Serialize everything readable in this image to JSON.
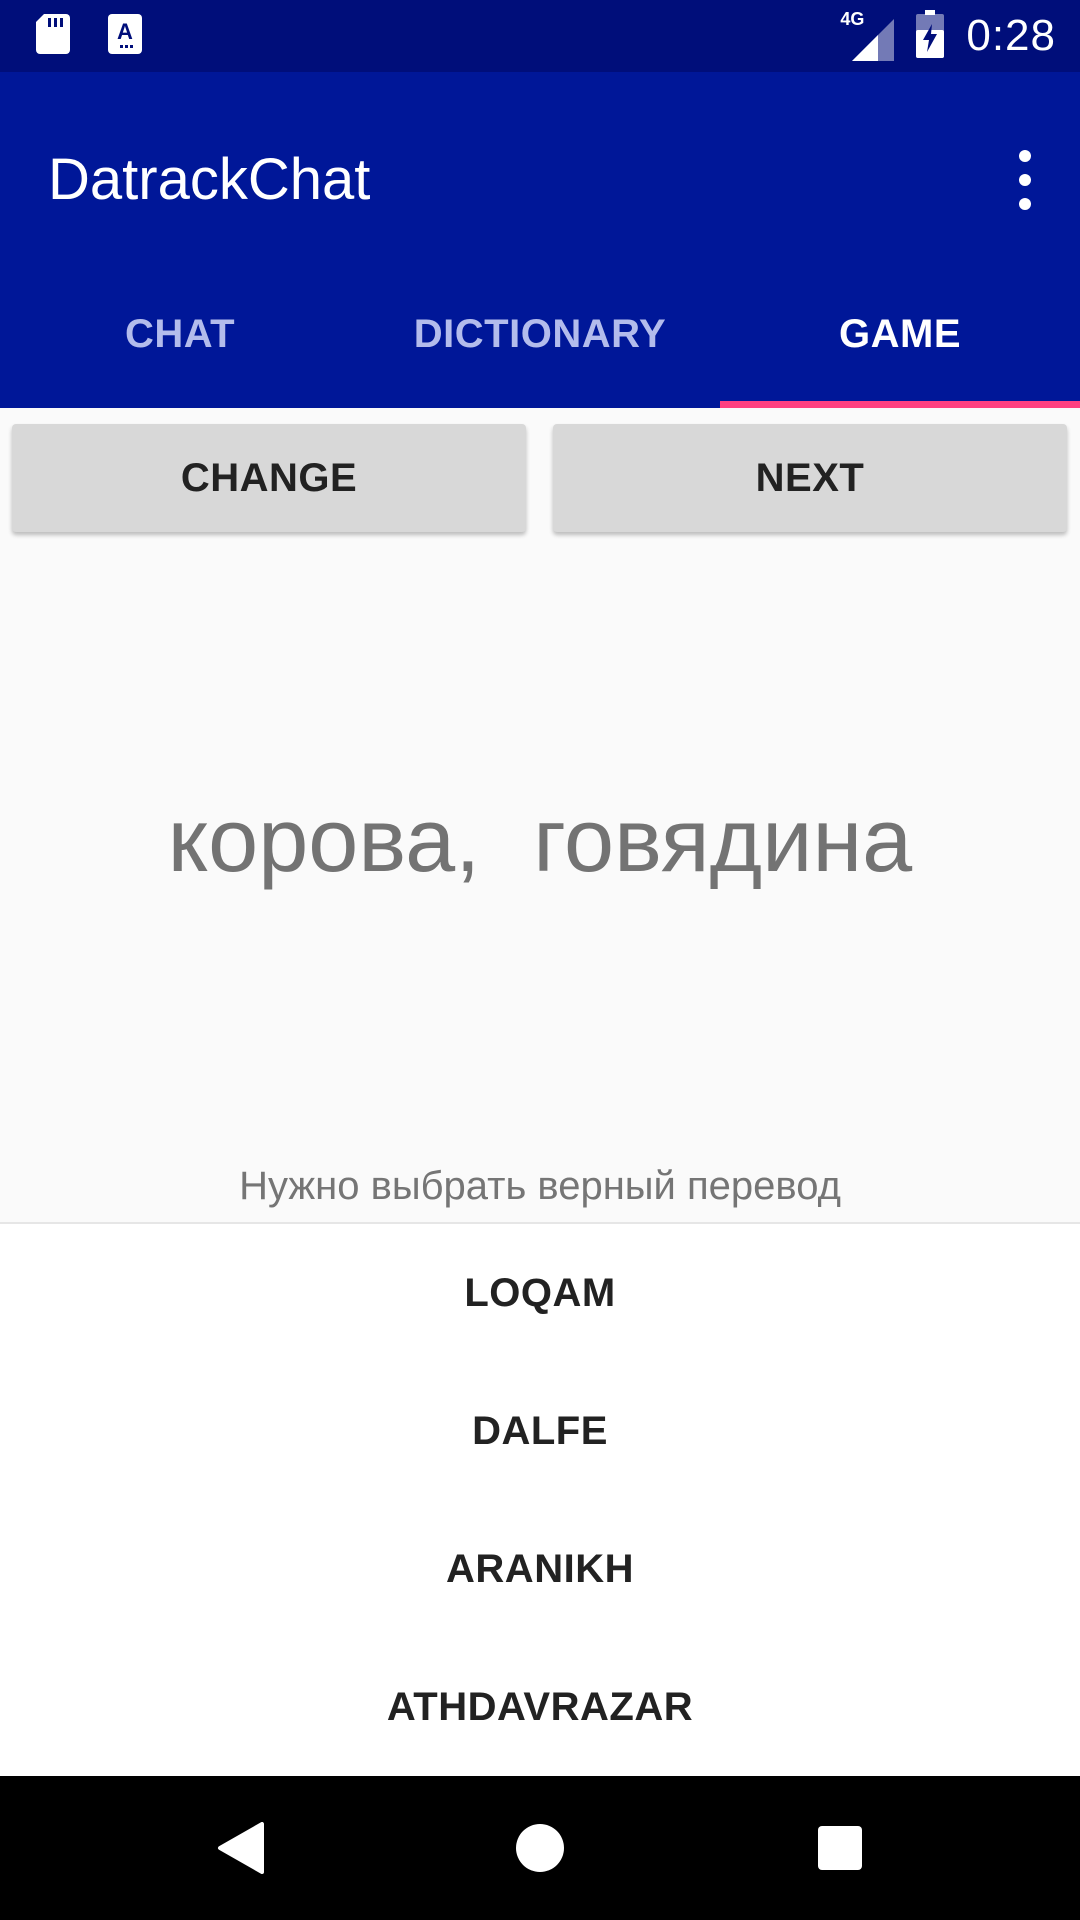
{
  "status_bar": {
    "time": "0:28",
    "network": "4G",
    "icons": [
      "sd-card-icon",
      "keyboard-icon",
      "signal-4g-icon",
      "battery-charging-icon"
    ]
  },
  "app_bar": {
    "title": "DatrackChat",
    "overflow_icon": "more-vert-icon"
  },
  "tabs": [
    {
      "label": "CHAT",
      "active": false
    },
    {
      "label": "DICTIONARY",
      "active": false
    },
    {
      "label": "GAME",
      "active": true
    }
  ],
  "actions": {
    "change_label": "CHANGE",
    "next_label": "NEXT"
  },
  "game": {
    "word": "корова, говядина",
    "hint": "Нужно выбрать верный перевод",
    "options": [
      "LOQAM",
      "DALFE",
      "ARANIKH",
      "ATHDAVRAZAR"
    ]
  },
  "colors": {
    "status_bar": "#000e7a",
    "primary": "#001798",
    "accent": "#ff4081",
    "button": "#d8d8d8"
  },
  "nav_bar": {
    "icons": [
      "back-icon",
      "home-icon",
      "recents-icon"
    ]
  }
}
